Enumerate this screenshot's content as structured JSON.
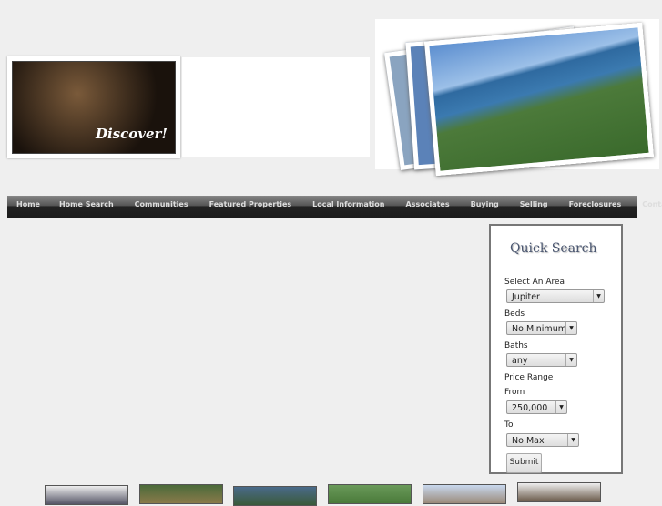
{
  "header": {
    "discover_text": "Discover!"
  },
  "nav": [
    "Home",
    "Home Search",
    "Communities",
    "Featured Properties",
    "Local Information",
    "Associates",
    "Buying",
    "Selling",
    "Foreclosures",
    "Contact"
  ],
  "quick_search": {
    "title": "Quick Search",
    "area_label": "Select An Area",
    "area_value": "Jupiter",
    "beds_label": "Beds",
    "beds_value": "No Minimum",
    "baths_label": "Baths",
    "baths_value": "any",
    "price_label": "Price Range",
    "from_label": "From",
    "from_value": "250,000",
    "to_label": "To",
    "to_value": "No Max",
    "submit": "Submit"
  }
}
